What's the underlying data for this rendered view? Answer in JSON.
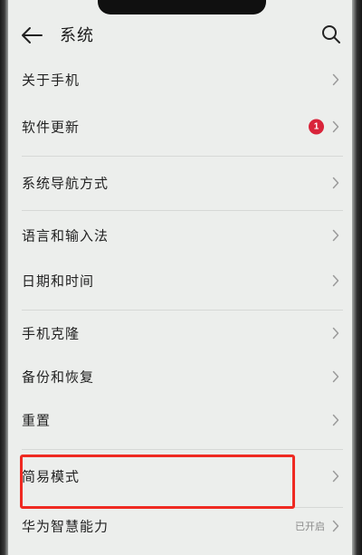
{
  "status_bar": {
    "corner_text": "..."
  },
  "header": {
    "title": "系统",
    "back_icon": "back-arrow-icon",
    "search_icon": "search-icon"
  },
  "menu": {
    "items": [
      {
        "label": "关于手机"
      },
      {
        "label": "软件更新",
        "badge": "1"
      },
      {
        "label": "系统导航方式"
      },
      {
        "label": "语言和输入法"
      },
      {
        "label": "日期和时间"
      },
      {
        "label": "手机克隆"
      },
      {
        "label": "备份和恢复"
      },
      {
        "label": "重置"
      },
      {
        "label": "简易模式",
        "highlighted": true
      },
      {
        "label": "华为智慧能力",
        "status": "已开启"
      }
    ]
  },
  "colors": {
    "badge": "#d9243a",
    "highlight": "#ef2a22",
    "background": "#eceeec"
  }
}
